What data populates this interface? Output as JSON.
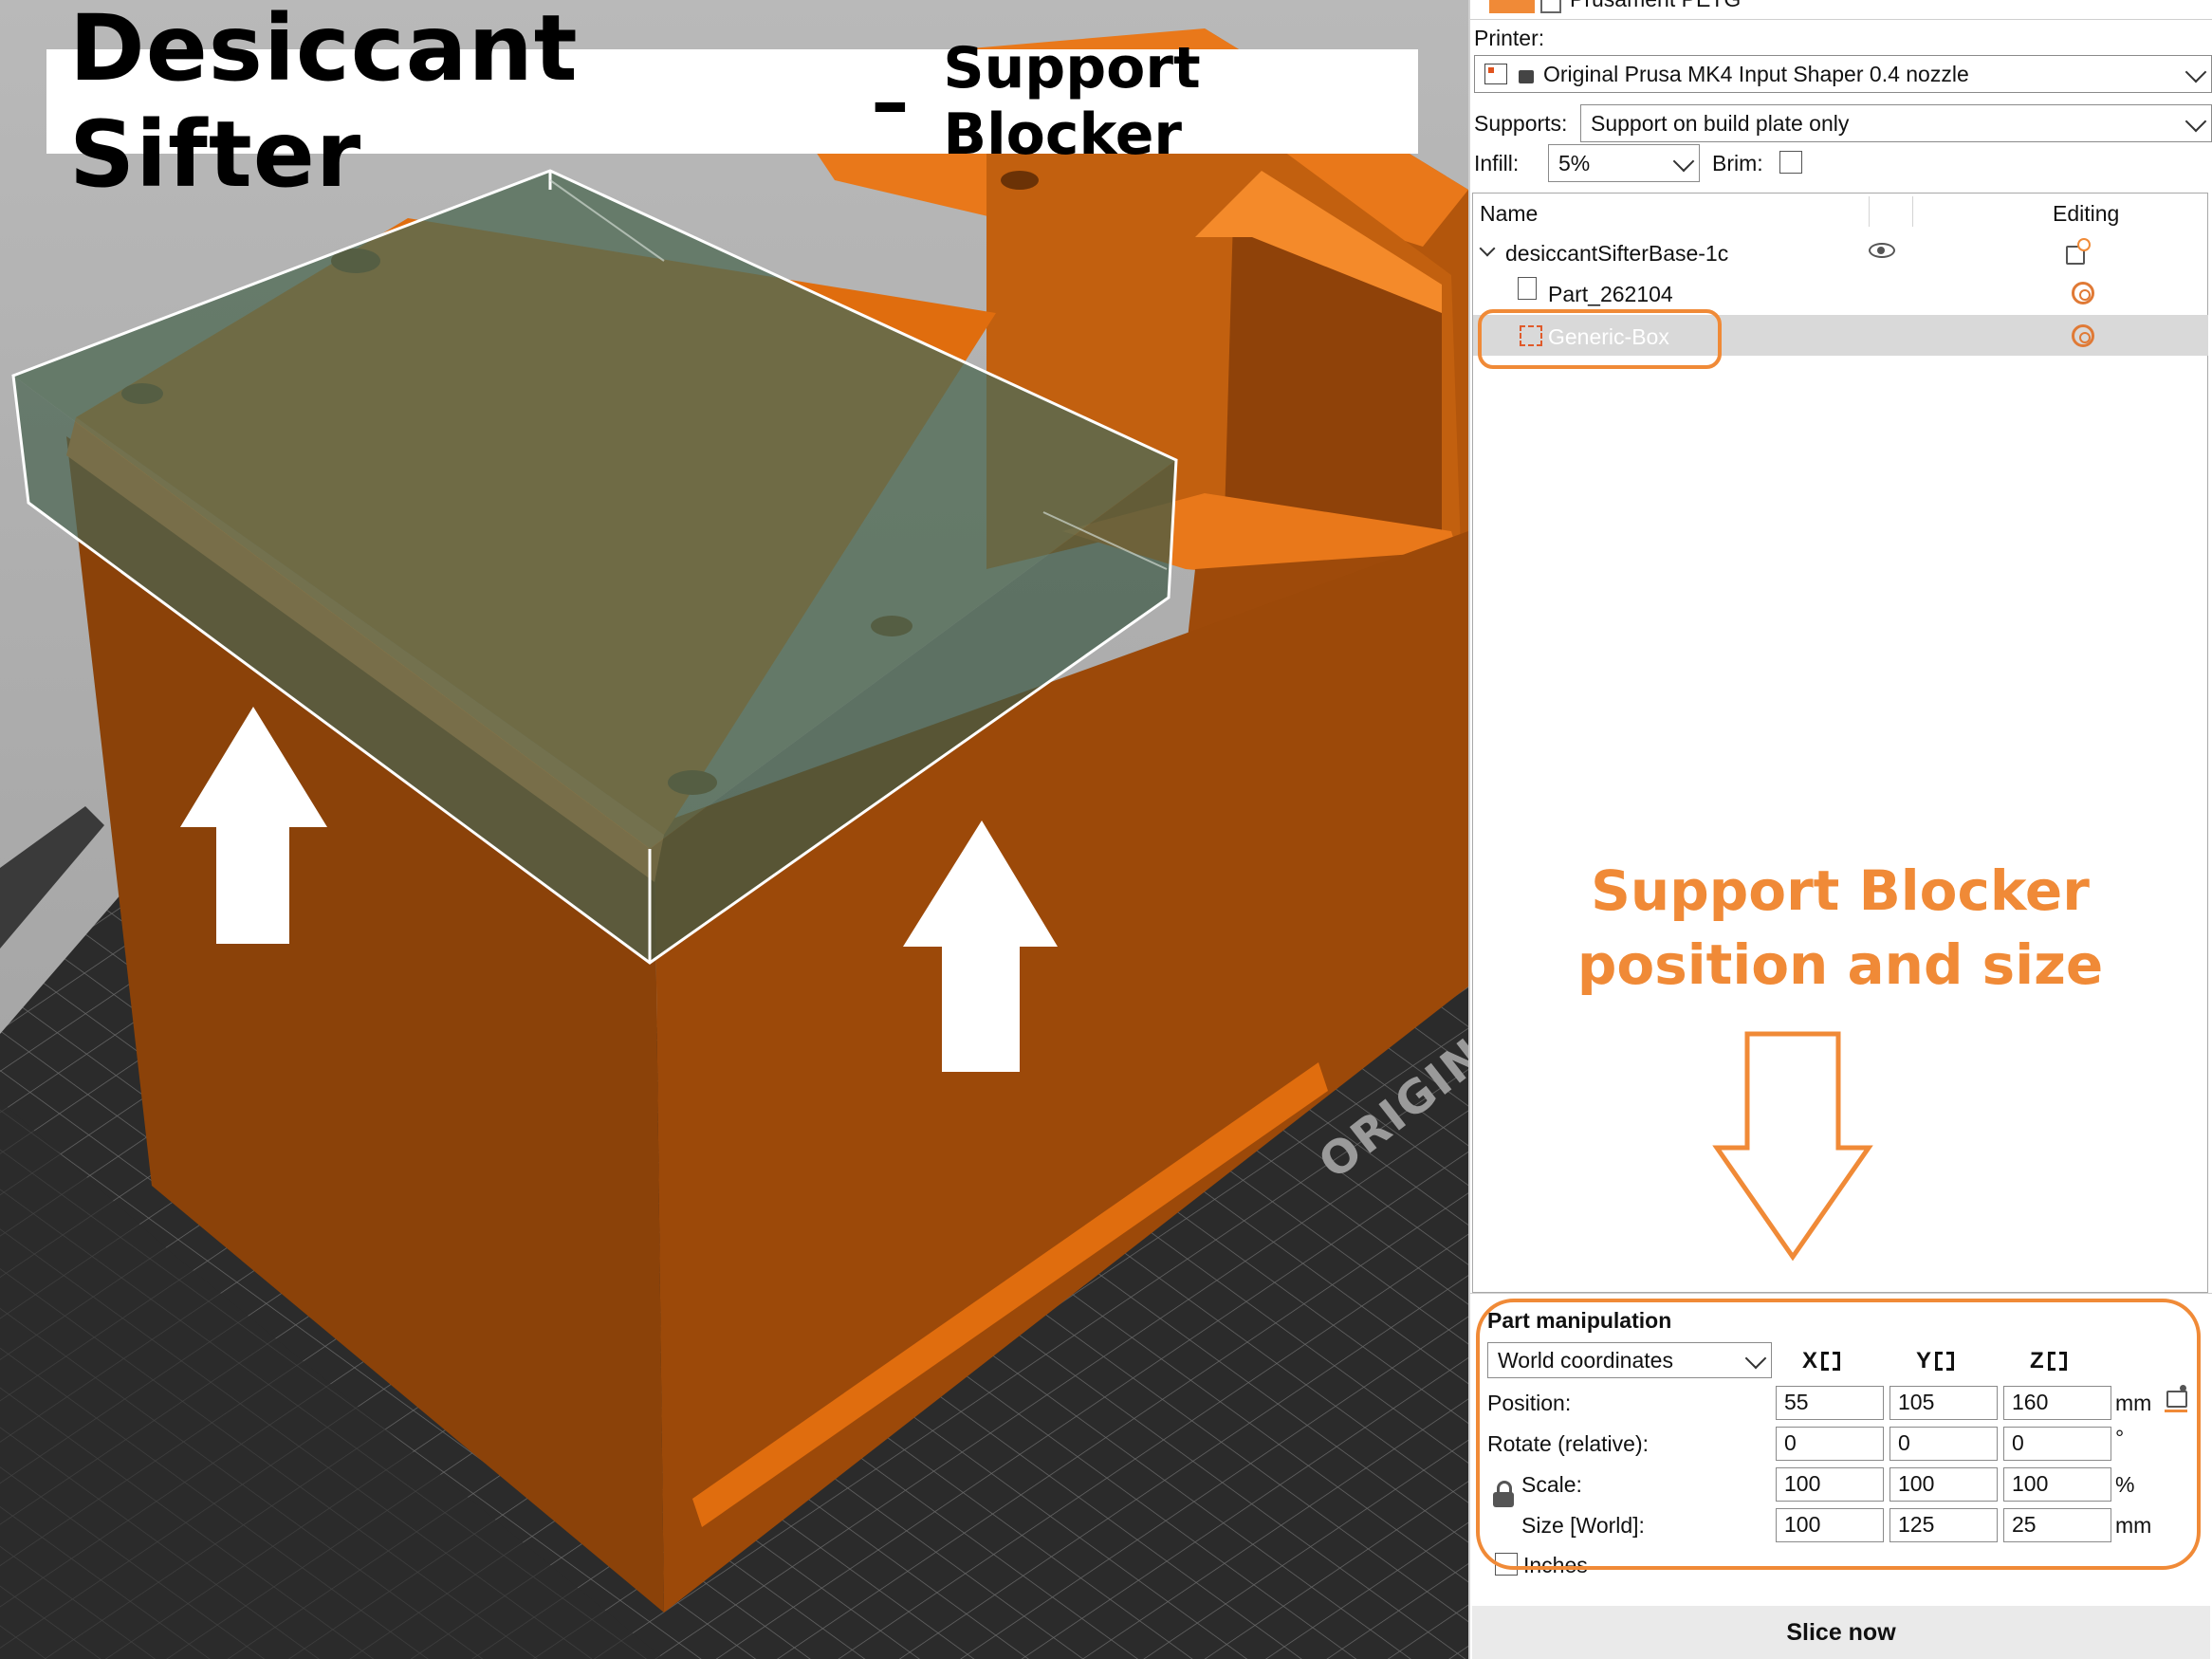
{
  "banner": {
    "title": "Desiccant Sifter",
    "dash": "–",
    "subtitle": "Support Blocker"
  },
  "bed": {
    "logo_text": "ORIGINAL"
  },
  "panel": {
    "filament_label": "Prusament PETG",
    "printer_label": "Printer:",
    "printer_value": "Original Prusa MK4 Input Shaper 0.4 nozzle",
    "supports_label": "Supports:",
    "supports_value": "Support on build plate only",
    "infill_label": "Infill:",
    "infill_value": "5%",
    "brim_label": "Brim:",
    "list": {
      "col_name": "Name",
      "col_editing": "Editing",
      "object_name": "desiccantSifterBase-1c",
      "parts": [
        {
          "label": "Part_262104"
        },
        {
          "label": "Generic-Box"
        }
      ]
    },
    "annotation": {
      "line1": "Support Blocker",
      "line2": "position and size"
    },
    "manip": {
      "title": "Part manipulation",
      "coord_system": "World coordinates",
      "axes": [
        "X",
        "Y",
        "Z"
      ],
      "rows": [
        {
          "label": "Position:",
          "values": [
            "55",
            "105",
            "160"
          ],
          "unit": "mm"
        },
        {
          "label": "Rotate (relative):",
          "values": [
            "0",
            "0",
            "0"
          ],
          "unit": "°"
        },
        {
          "label": "Scale:",
          "values": [
            "100",
            "100",
            "100"
          ],
          "unit": "%"
        },
        {
          "label": "Size [World]:",
          "values": [
            "100",
            "125",
            "25"
          ],
          "unit": "mm"
        }
      ],
      "inches_label": "Inches"
    },
    "slice_button": "Slice now"
  },
  "colors": {
    "accent_orange": "#f08a37",
    "model_orange": "#e06d0e",
    "blocker_green": "#5d7a62"
  }
}
